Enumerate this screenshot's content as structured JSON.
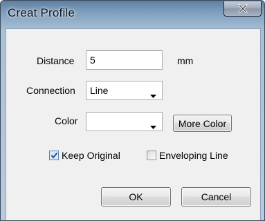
{
  "dialog": {
    "title": "Creat Profile",
    "close_symbol": "x"
  },
  "distance": {
    "label": "Distance",
    "value": "5",
    "unit": "mm"
  },
  "connection": {
    "label": "Connection",
    "value": "Line"
  },
  "color": {
    "label": "Color",
    "value": "",
    "more_color_label": "More Color"
  },
  "options": {
    "keep_original": {
      "label": "Keep Original",
      "checked": true
    },
    "enveloping_line": {
      "label": "Enveloping Line",
      "checked": false
    }
  },
  "buttons": {
    "ok": "OK",
    "cancel": "Cancel"
  },
  "icons": {
    "close": "close-icon",
    "dropdown": "chevron-down-icon",
    "check": "checkmark-icon"
  },
  "colors": {
    "title_gradient_top": "#5e7fa0",
    "client_background": "#f0f0f0",
    "check_accent": "#3a6fb0"
  }
}
